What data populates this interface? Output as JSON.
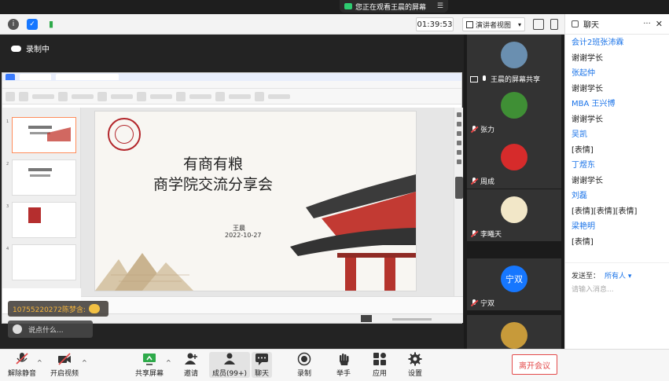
{
  "banner": {
    "text": "您正在观看王晨的屏幕"
  },
  "topbar": {
    "timer": "01:39:53",
    "view_mode": "演讲者视图"
  },
  "share": {
    "recording": "录制中",
    "slide": {
      "title_line1": "有商有粮",
      "title_line2": "商学院交流分享会",
      "author": "王晨",
      "date": "2022-10-27"
    },
    "toast": "10755220272陈梦含:",
    "chat_placeholder": "说点什么..."
  },
  "participants": [
    {
      "name": "王晨的屏幕共享",
      "mic": "share",
      "avatar_color": "#6a8fb0"
    },
    {
      "name": "张力",
      "mic": "muted",
      "avatar_color": "#3f8f35"
    },
    {
      "name": "周成",
      "mic": "muted",
      "avatar_color": "#d62b2b"
    },
    {
      "name": "李曦天",
      "mic": "muted",
      "avatar_color": "#f2e7c8"
    },
    {
      "name": "宁双",
      "mic": "muted",
      "avatar_color": "#1677ff",
      "avatar_text": "宁双"
    },
    {
      "name": "",
      "mic": "",
      "avatar_color": "#c79a3a"
    }
  ],
  "chat": {
    "title": "聊天",
    "messages": [
      {
        "kind": "name",
        "text": "会计2班张沛霖"
      },
      {
        "kind": "text",
        "text": "谢谢学长"
      },
      {
        "kind": "name",
        "text": "张起仲"
      },
      {
        "kind": "text",
        "text": "谢谢学长"
      },
      {
        "kind": "name",
        "text": "MBA 王兴博"
      },
      {
        "kind": "text",
        "text": "谢谢学长"
      },
      {
        "kind": "name",
        "text": "吴凯"
      },
      {
        "kind": "text",
        "text": "[表情]"
      },
      {
        "kind": "name",
        "text": "丁煜东"
      },
      {
        "kind": "text",
        "text": "谢谢学长"
      },
      {
        "kind": "name",
        "text": "刘磊"
      },
      {
        "kind": "text",
        "text": "[表情][表情][表情]"
      },
      {
        "kind": "name",
        "text": "梁艳明"
      },
      {
        "kind": "text",
        "text": "[表情]"
      }
    ],
    "send_to_label": "发送至：",
    "send_to_value": "所有人",
    "input_placeholder": "请输入消息..."
  },
  "toolbar": {
    "unmute": "解除静音",
    "video": "开启视频",
    "share": "共享屏幕",
    "invite": "邀请",
    "members": "成员(99+)",
    "chat": "聊天",
    "record": "录制",
    "raise": "举手",
    "apps": "应用",
    "settings": "设置",
    "leave": "离开会议"
  }
}
